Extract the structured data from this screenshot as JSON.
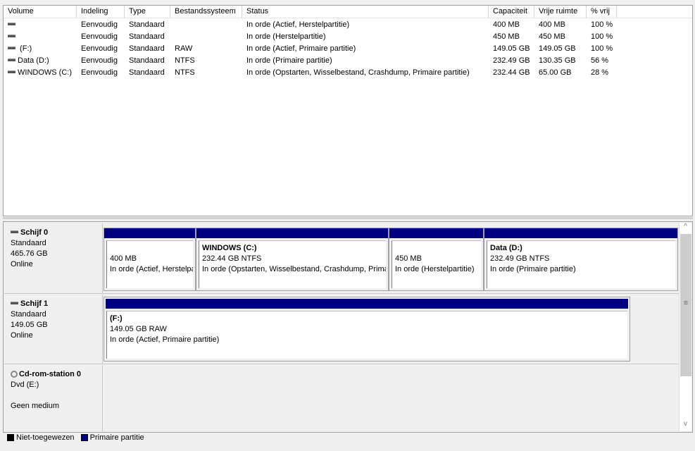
{
  "columns": [
    "Volume",
    "Indeling",
    "Type",
    "Bestandssysteem",
    "Status",
    "Capaciteit",
    "Vrije ruimte",
    "% vrij"
  ],
  "volumes": [
    {
      "volume": "",
      "layout": "Eenvoudig",
      "type": "Standaard",
      "fs": "",
      "status": "In orde (Actief, Herstelpartitie)",
      "capacity": "400 MB",
      "free": "400 MB",
      "pct": "100 %"
    },
    {
      "volume": "",
      "layout": "Eenvoudig",
      "type": "Standaard",
      "fs": "",
      "status": "In orde (Herstelpartitie)",
      "capacity": "450 MB",
      "free": "450 MB",
      "pct": "100 %"
    },
    {
      "volume": " (F:)",
      "layout": "Eenvoudig",
      "type": "Standaard",
      "fs": "RAW",
      "status": "In orde (Actief, Primaire partitie)",
      "capacity": "149.05 GB",
      "free": "149.05 GB",
      "pct": "100 %"
    },
    {
      "volume": "Data (D:)",
      "layout": "Eenvoudig",
      "type": "Standaard",
      "fs": "NTFS",
      "status": "In orde (Primaire partitie)",
      "capacity": "232.49 GB",
      "free": "130.35 GB",
      "pct": "56 %"
    },
    {
      "volume": "WINDOWS (C:)",
      "layout": "Eenvoudig",
      "type": "Standaard",
      "fs": "NTFS",
      "status": "In orde (Opstarten, Wisselbestand, Crashdump, Primaire partitie)",
      "capacity": "232.44 GB",
      "free": "65.00 GB",
      "pct": "28 %"
    }
  ],
  "disks": [
    {
      "name": "Schijf 0",
      "type": "Standaard",
      "size": "465.76 GB",
      "state": "Online",
      "partitions": [
        {
          "title": "",
          "size": "400 MB",
          "status": "In orde (Actief, Herstelpartitie)"
        },
        {
          "title": "WINDOWS  (C:)",
          "size": "232.44 GB NTFS",
          "status": "In orde (Opstarten, Wisselbestand, Crashdump, Primaire partitie)"
        },
        {
          "title": "",
          "size": "450 MB",
          "status": "In orde (Herstelpartitie)"
        },
        {
          "title": "Data  (D:)",
          "size": "232.49 GB NTFS",
          "status": "In orde (Primaire partitie)"
        }
      ]
    },
    {
      "name": "Schijf 1",
      "type": "Standaard",
      "size": "149.05 GB",
      "state": "Online",
      "partitions": [
        {
          "title": " (F:)",
          "size": "149.05 GB RAW",
          "status": "In orde (Actief, Primaire partitie)"
        }
      ]
    },
    {
      "name": "Cd-rom-station 0",
      "type": "Dvd (E:)",
      "size": "",
      "state": "Geen medium"
    }
  ],
  "legend": [
    {
      "label": "Niet-toegewezen",
      "color": "#000000"
    },
    {
      "label": "Primaire partitie",
      "color": "#000080"
    }
  ],
  "scroll": {
    "up": "^",
    "down": "v",
    "grip": "≡"
  }
}
